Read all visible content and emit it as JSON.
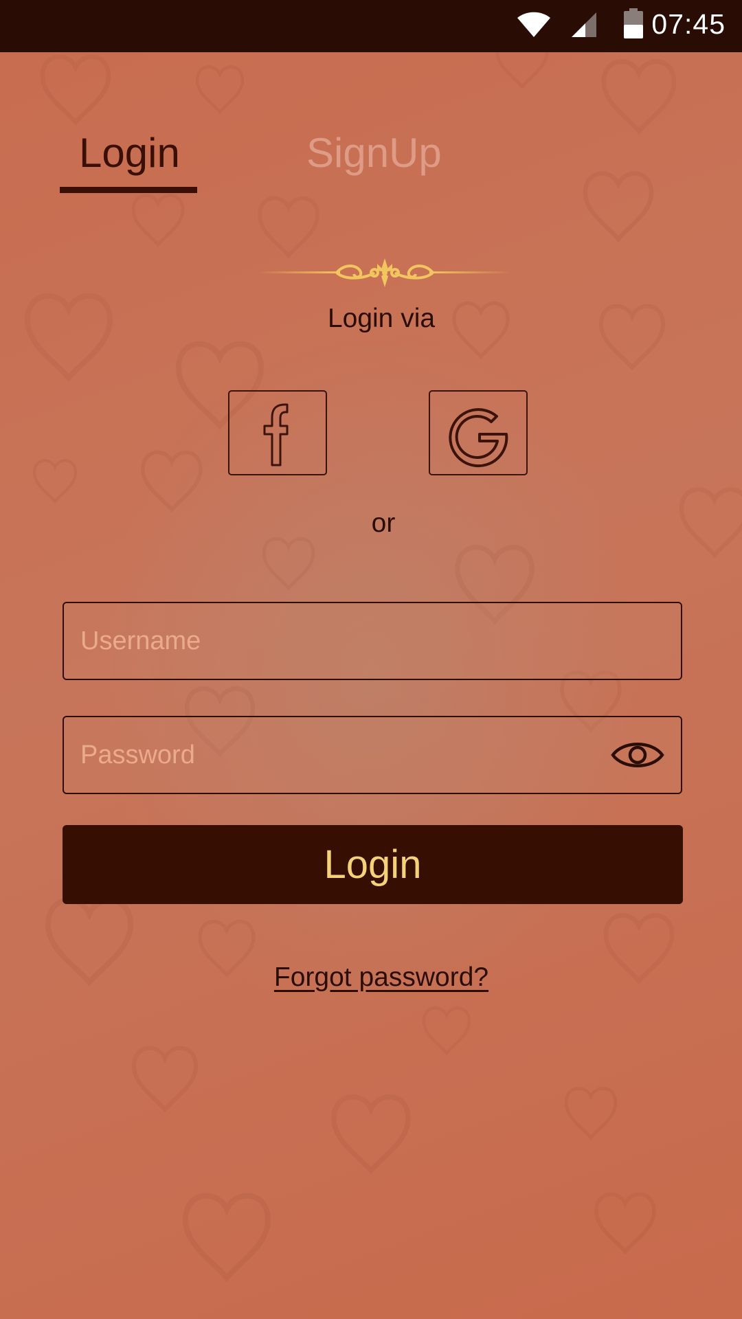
{
  "status_bar": {
    "time": "07:45",
    "icons": [
      "wifi-icon",
      "signal-icon",
      "battery-icon"
    ]
  },
  "tabs": [
    {
      "label": "Login",
      "active": true
    },
    {
      "label": "SignUp",
      "active": false
    }
  ],
  "login_via_label": "Login via",
  "social": {
    "facebook_icon": "facebook-icon",
    "google_icon": "google-icon"
  },
  "or_label": "or",
  "form": {
    "username_placeholder": "Username",
    "username_value": "",
    "password_placeholder": "Password",
    "password_value": "",
    "password_toggle_icon": "eye-icon",
    "submit_label": "Login"
  },
  "forgot_password_label": "Forgot password?",
  "colors": {
    "background": "#c96a4c",
    "status_bar": "#290c03",
    "button_bg": "#360e02",
    "button_text": "#f5d27a",
    "ornament_gold": "#f2c65e",
    "dark_text": "#2a0d05"
  }
}
